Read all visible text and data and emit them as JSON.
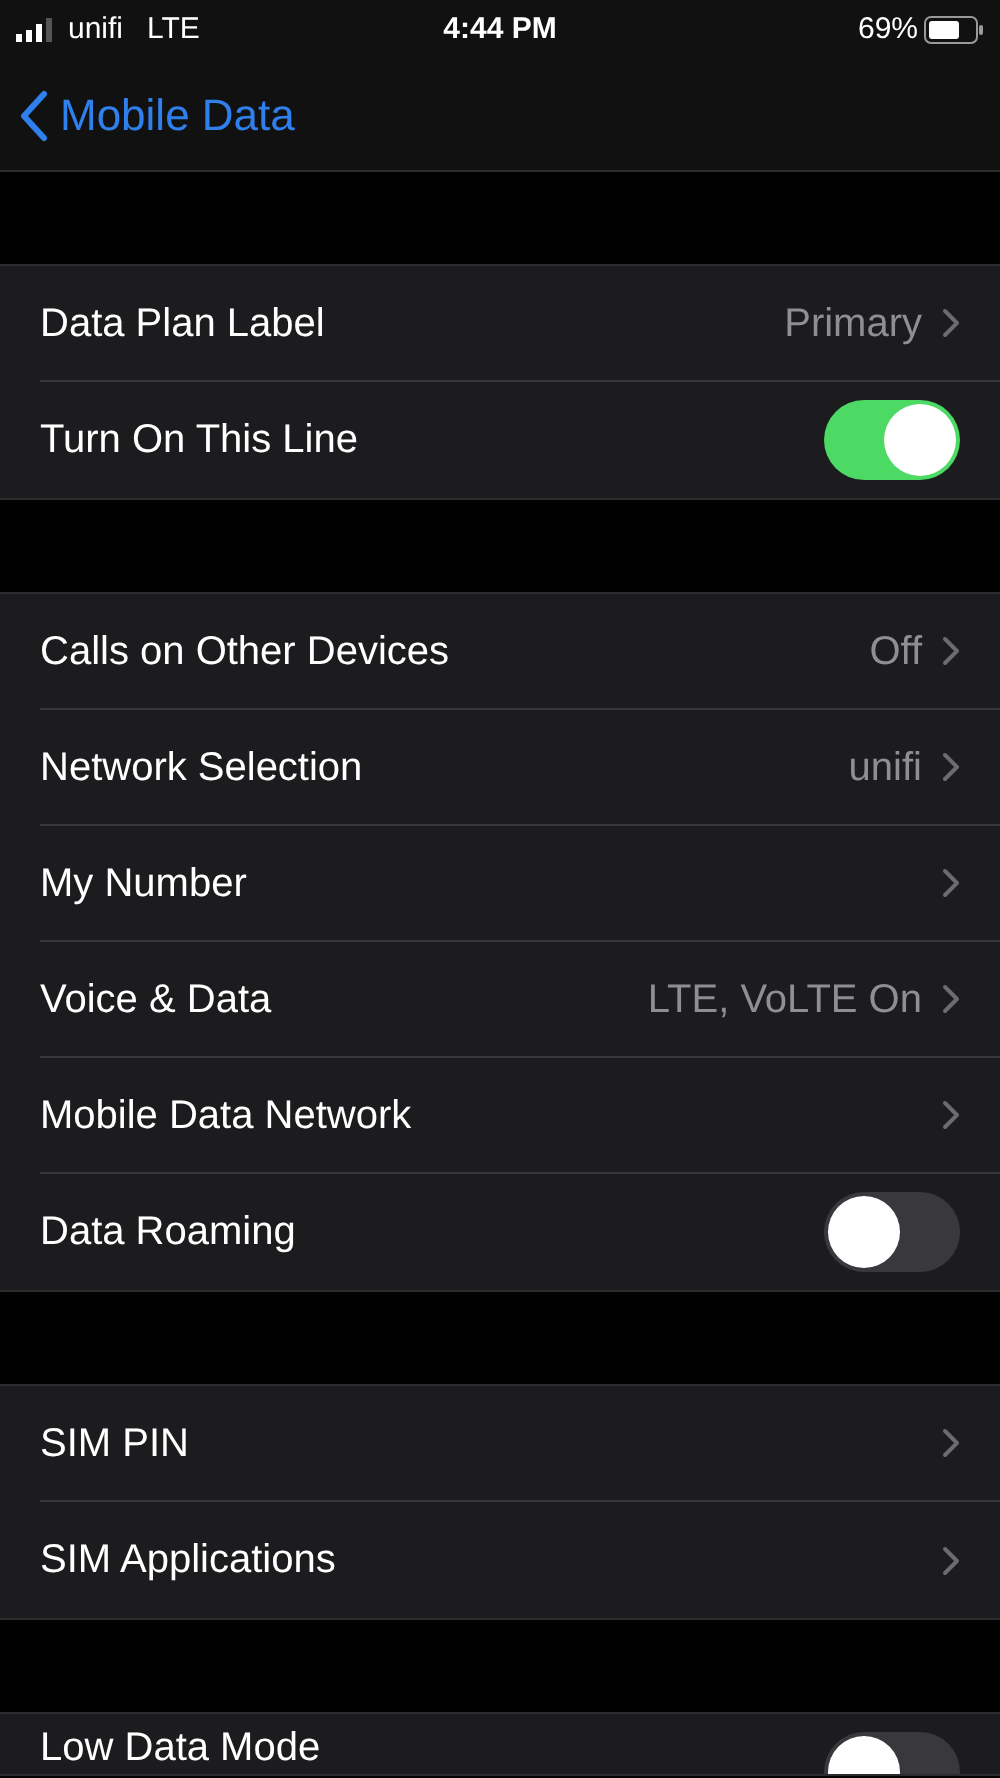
{
  "status_bar": {
    "carrier": "unifi",
    "network": "LTE",
    "time": "4:44 PM",
    "battery": "69%"
  },
  "nav": {
    "back_label": "Mobile Data"
  },
  "groups": [
    {
      "rows": [
        {
          "kind": "link",
          "label": "Data Plan Label",
          "value": "Primary"
        },
        {
          "kind": "toggle",
          "label": "Turn On This Line",
          "on": true
        }
      ]
    },
    {
      "rows": [
        {
          "kind": "link",
          "label": "Calls on Other Devices",
          "value": "Off"
        },
        {
          "kind": "link",
          "label": "Network Selection",
          "value": "unifi"
        },
        {
          "kind": "link",
          "label": "My Number"
        },
        {
          "kind": "link",
          "label": "Voice & Data",
          "value": "LTE, VoLTE On"
        },
        {
          "kind": "link",
          "label": "Mobile Data Network"
        },
        {
          "kind": "toggle",
          "label": "Data Roaming",
          "on": false
        }
      ]
    },
    {
      "rows": [
        {
          "kind": "link",
          "label": "SIM PIN"
        },
        {
          "kind": "link",
          "label": "SIM Applications"
        }
      ]
    },
    {
      "rows": [
        {
          "kind": "toggle",
          "label": "Low Data Mode",
          "on": false
        }
      ]
    }
  ]
}
